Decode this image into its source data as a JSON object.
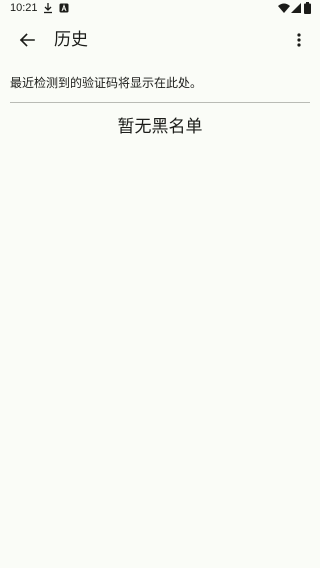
{
  "status_bar": {
    "time": "10:21",
    "icons": [
      "download-icon",
      "a-badge-icon",
      "wifi-icon",
      "cellular-signal-icon",
      "battery-icon"
    ]
  },
  "app_bar": {
    "back_icon": "arrow-back-icon",
    "title": "历史",
    "more_icon": "more-vert-icon"
  },
  "content": {
    "description": "最近检测到的验证码将显示在此处。",
    "empty_message": "暂无黑名单"
  },
  "colors": {
    "background": "#fafcf7",
    "text": "#1b1c19",
    "divider": "#b9bbb5"
  }
}
